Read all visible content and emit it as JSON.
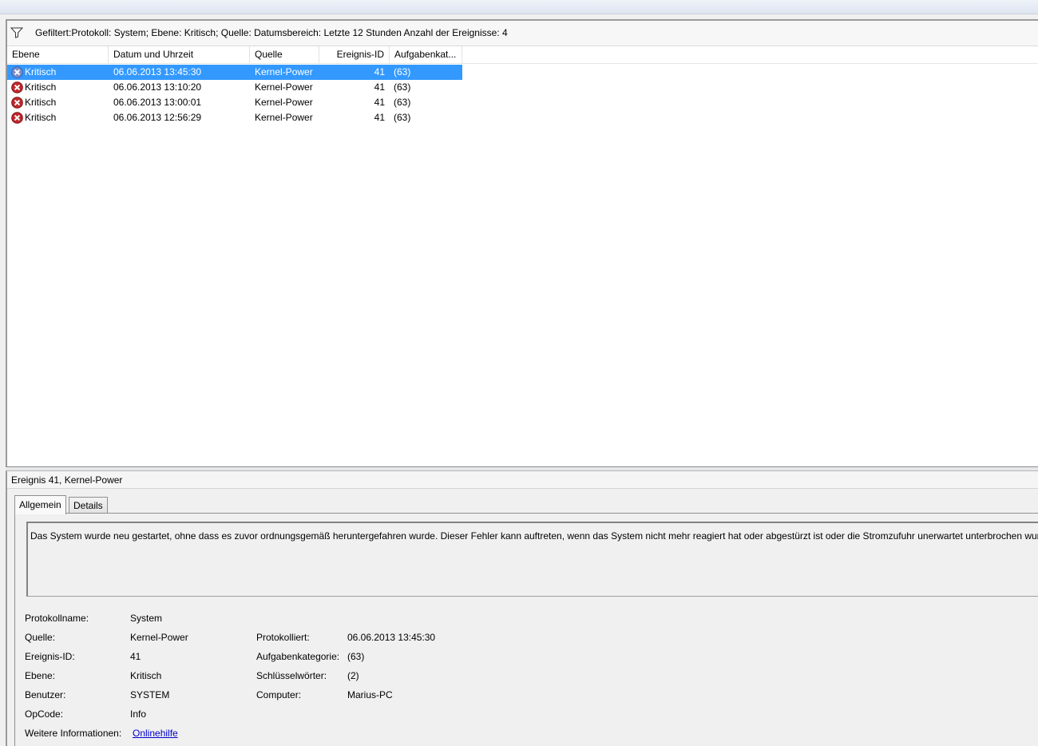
{
  "filter": {
    "text": "Gefiltert:Protokoll: System; Ebene: Kritisch; Quelle: Datumsbereich: Letzte 12 Stunden Anzahl der Ereignisse: 4",
    "icon": "filter-funnel-icon"
  },
  "columns": {
    "level": "Ebene",
    "date": "Datum und Uhrzeit",
    "source": "Quelle",
    "event_id": "Ereignis-ID",
    "task": "Aufgabenkat..."
  },
  "events": [
    {
      "level": "Kritisch",
      "date": "06.06.2013 13:45:30",
      "source": "Kernel-Power",
      "event_id": "41",
      "task": "(63)",
      "selected": true
    },
    {
      "level": "Kritisch",
      "date": "06.06.2013 13:10:20",
      "source": "Kernel-Power",
      "event_id": "41",
      "task": "(63)",
      "selected": false
    },
    {
      "level": "Kritisch",
      "date": "06.06.2013 13:00:01",
      "source": "Kernel-Power",
      "event_id": "41",
      "task": "(63)",
      "selected": false
    },
    {
      "level": "Kritisch",
      "date": "06.06.2013 12:56:29",
      "source": "Kernel-Power",
      "event_id": "41",
      "task": "(63)",
      "selected": false
    }
  ],
  "detail": {
    "title": "Ereignis 41, Kernel-Power",
    "tabs": [
      "Allgemein",
      "Details"
    ],
    "active_tab": "Allgemein",
    "description": "Das System wurde neu gestartet, ohne dass es zuvor ordnungsgemäß heruntergefahren wurde. Dieser Fehler kann auftreten, wenn das System nicht mehr reagiert hat oder abgestürzt ist oder die Stromzufuhr unerwartet unterbrochen wurde.",
    "labels": {
      "log_name": "Protokollname:",
      "source": "Quelle:",
      "event_id": "Ereignis-ID:",
      "level": "Ebene:",
      "user": "Benutzer:",
      "opcode": "OpCode:",
      "more_info": "Weitere Informationen:",
      "logged": "Protokolliert:",
      "task_category": "Aufgabenkategorie:",
      "keywords": "Schlüsselwörter:",
      "computer": "Computer:"
    },
    "values": {
      "log_name": "System",
      "source": "Kernel-Power",
      "event_id": "41",
      "level": "Kritisch",
      "user": "SYSTEM",
      "opcode": "Info",
      "more_info": "Onlinehilfe",
      "logged": "06.06.2013 13:45:30",
      "task_category": "(63)",
      "keywords": "(2)",
      "computer": "Marius-PC"
    }
  },
  "colors": {
    "selection": "#3399ff",
    "critical_icon": "#c0282d",
    "link": "#0000cc"
  }
}
